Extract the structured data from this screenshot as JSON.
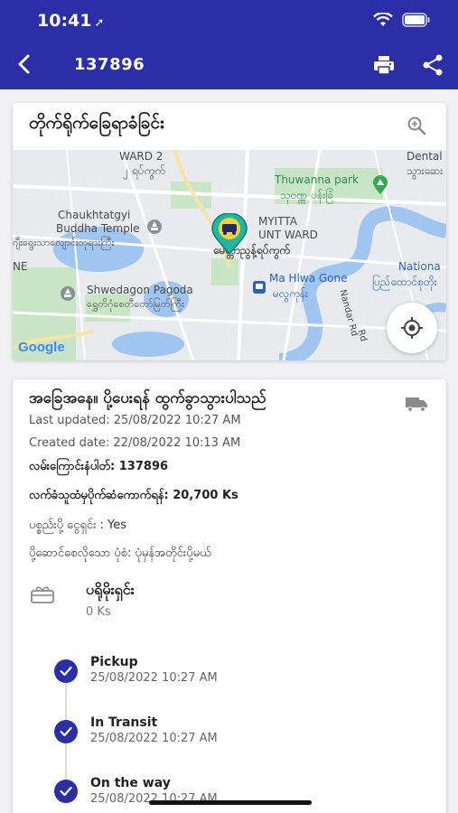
{
  "status_bar": {
    "time": "10:41",
    "location_arrow": "➚"
  },
  "header": {
    "title": "137896",
    "back_icon": "chevron-left",
    "print_icon": "printer",
    "share_icon": "share"
  },
  "map_card": {
    "title": "တိုက်ရိုက်ခြေရာခံခြင်း",
    "labels": {
      "ward2_en": "WARD 2",
      "ward2_my": "၂ ရပ်ကွက်",
      "dental": "Dental",
      "dental_my": "သွားဆေး",
      "thuwanna": "Thuwanna park",
      "thuwanna_my": "သုဝဏ္ဏ ပန်းခြံ",
      "chauk1": "Chaukhtatgyi",
      "chauk2": "Buddha Temple",
      "chauk_my": "ဂျီးရွေးသာလျောင်းဘုရားကြီး",
      "myitta1": "MYITTA",
      "myitta2": "UNT WARD",
      "myitta_my": "မေတ္တာညွန့်ရပ်ကွက်",
      "ne": "NE",
      "national": "Nationa",
      "national_my": "ပြည်ထောင်စုတိုး",
      "shwedagon": "Shwedagon Pagoda",
      "shwedagon_my": "ရွှေတိဂုံစေတီတော်မြတ်ကြီး",
      "mahlwa": "Ma Hlwa Gone",
      "mahlwa_my": "မလွကုန်း",
      "nandar": "Nandar Rd",
      "road": "Rd",
      "google": "Google"
    }
  },
  "detail_card": {
    "status_heading": "အခြေအနေ။  ပို့ပေးရန် ထွက်ခွာသွားပါသည်",
    "last_updated": "Last updated: 25/08/2022 10:27 AM",
    "created_date": "Created date: 22/08/2022 10:13 AM",
    "tracking_number": "လမ်းကြောင်းနံပါတ်: 137896",
    "cod_amount": "လက်ခံသူထံမှပိုက်ဆံကောက်ရန်: 20,700 Ks",
    "payment_by_sender": "ပစ္စည်းပို့ ငွေရှင်း : Yes",
    "delivery_type": "ပို့ဆောင်စေလိုသော ပုံစံ: ပုံမှန်အတိုင်းပို့မယ်",
    "package_title": "ပရိုမိုးရှင်း",
    "package_amount": "0 Ks"
  },
  "timeline": [
    {
      "title": "Pickup",
      "date": "25/08/2022 10:27 AM"
    },
    {
      "title": "In Transit",
      "date": "25/08/2022 10:27 AM"
    },
    {
      "title": "On the way",
      "date": "25/08/2022 10:27 AM"
    }
  ],
  "colors": {
    "primary": "#2a2fa8",
    "map_water": "#9fc5f0",
    "map_park": "#c8e6c5",
    "pin": "#1fb6a5"
  }
}
